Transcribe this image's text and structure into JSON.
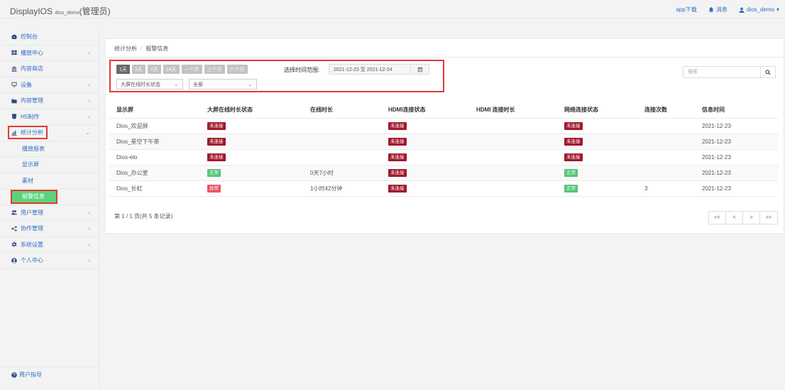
{
  "app": {
    "title": "DisplayIOS",
    "user_small": "dios_demo",
    "role": "(管理员)"
  },
  "topnav": {
    "download": "app下载",
    "messages": "消息",
    "user": "dios_demo"
  },
  "sidebar": {
    "items": [
      {
        "label": "控制台",
        "icon": "dashboard-icon",
        "chevron": ""
      },
      {
        "label": "播放中心",
        "icon": "grid-icon",
        "chevron": "‹"
      },
      {
        "label": "内容商店",
        "icon": "store-icon",
        "chevron": ""
      },
      {
        "label": "设备",
        "icon": "monitor-icon",
        "chevron": "‹"
      },
      {
        "label": "内容管理",
        "icon": "folder-icon",
        "chevron": "‹"
      },
      {
        "label": "H5制作",
        "icon": "h5-icon",
        "chevron": "‹"
      },
      {
        "label": "统计分析",
        "icon": "chart-icon",
        "chevron": "⌄"
      }
    ],
    "sub_items": [
      {
        "label": "播放报表"
      },
      {
        "label": "显示屏"
      },
      {
        "label": "素材"
      }
    ],
    "current": "报警信息",
    "more_items": [
      {
        "label": "用户管理",
        "icon": "users-icon",
        "chevron": "‹"
      },
      {
        "label": "协作管理",
        "icon": "share-icon",
        "chevron": "‹"
      },
      {
        "label": "系统设置",
        "icon": "gear-icon",
        "chevron": "‹"
      },
      {
        "label": "个人中心",
        "icon": "user-circle-icon",
        "chevron": "‹"
      }
    ],
    "footer": "用户指导"
  },
  "breadcrumb": {
    "parent": "统计分析",
    "current": "报警信息"
  },
  "filters": {
    "ranges": [
      "1天",
      "3天",
      "7天",
      "14天",
      "一个月",
      "三个月",
      "六个月"
    ],
    "active_range": "1天",
    "range_label": "选择时间范围:",
    "date_range": "2021-12-23 至 2021-12-24",
    "select1": "大屏在线时长状态",
    "select2": "全部"
  },
  "search": {
    "placeholder": "搜索"
  },
  "table": {
    "headers": [
      "显示屏",
      "大屏在线时长状态",
      "在线时长",
      "HDMI连接状态",
      "HDMI 连接时长",
      "网络连接状态",
      "连接次数",
      "信息时间"
    ],
    "rows": [
      {
        "name": "Dios_欢迎屏",
        "online_status": "未连接",
        "online_duration": "",
        "hdmi_status": "未连接",
        "hdmi_duration": "",
        "net_status": "未连接",
        "count": "",
        "time": "2021-12-23"
      },
      {
        "name": "Dios_星空下午茶",
        "online_status": "未连接",
        "online_duration": "",
        "hdmi_status": "未连接",
        "hdmi_duration": "",
        "net_status": "未连接",
        "count": "",
        "time": "2021-12-23"
      },
      {
        "name": "Dios-elo",
        "online_status": "未连接",
        "online_duration": "",
        "hdmi_status": "未连接",
        "hdmi_duration": "",
        "net_status": "未连接",
        "count": "",
        "time": "2021-12-23"
      },
      {
        "name": "Dios_办公室",
        "online_status": "正常",
        "online_duration": "0天7小时",
        "hdmi_status": "未连接",
        "hdmi_duration": "",
        "net_status": "正常",
        "count": "",
        "time": "2021-12-23"
      },
      {
        "name": "Dios_长虹",
        "online_status": "异常",
        "online_duration": "1小时42分钟",
        "hdmi_status": "未连接",
        "hdmi_duration": "",
        "net_status": "正常",
        "count": "3",
        "time": "2021-12-23"
      }
    ]
  },
  "pagination": {
    "info": "第 1 / 1 页(共 5 条记录)",
    "first": "<<",
    "prev": "<",
    "next": ">",
    "last": ">>"
  },
  "colors": {
    "link": "#2f6fc0",
    "badge_unconnected": "#a0192b",
    "badge_ok": "#56c57a",
    "badge_abnormal": "#ec5765",
    "highlight_border": "#e23a31",
    "active_menu": "#5cd27b"
  }
}
